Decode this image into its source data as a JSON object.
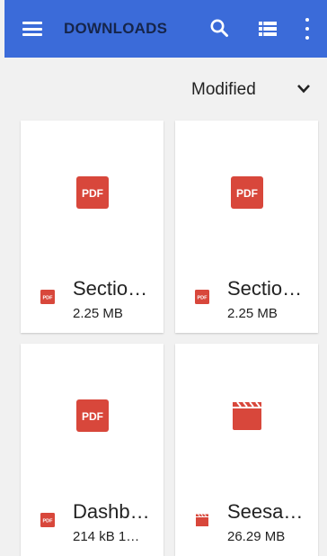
{
  "appbar": {
    "title": "DOWNLOADS",
    "accent_color": "#3b6bd9",
    "icons": [
      "menu-icon",
      "search-icon",
      "list-view-icon",
      "more-vert-icon"
    ]
  },
  "sort": {
    "label": "Modified",
    "icon": "chevron-down-icon"
  },
  "files": [
    {
      "name": "Sectio…",
      "meta": "2.25 MB",
      "type": "pdf",
      "badge": "PDF"
    },
    {
      "name": "Sectio…",
      "meta": "2.25 MB",
      "type": "pdf",
      "badge": "PDF"
    },
    {
      "name": "Dashb…",
      "meta": "214 kB 1…",
      "type": "pdf",
      "badge": "PDF"
    },
    {
      "name": "Seesa…",
      "meta": "26.29 MB",
      "type": "video",
      "badge": ""
    }
  ],
  "colors": {
    "file_icon_red": "#d8473b",
    "background": "#f1f1f1"
  }
}
